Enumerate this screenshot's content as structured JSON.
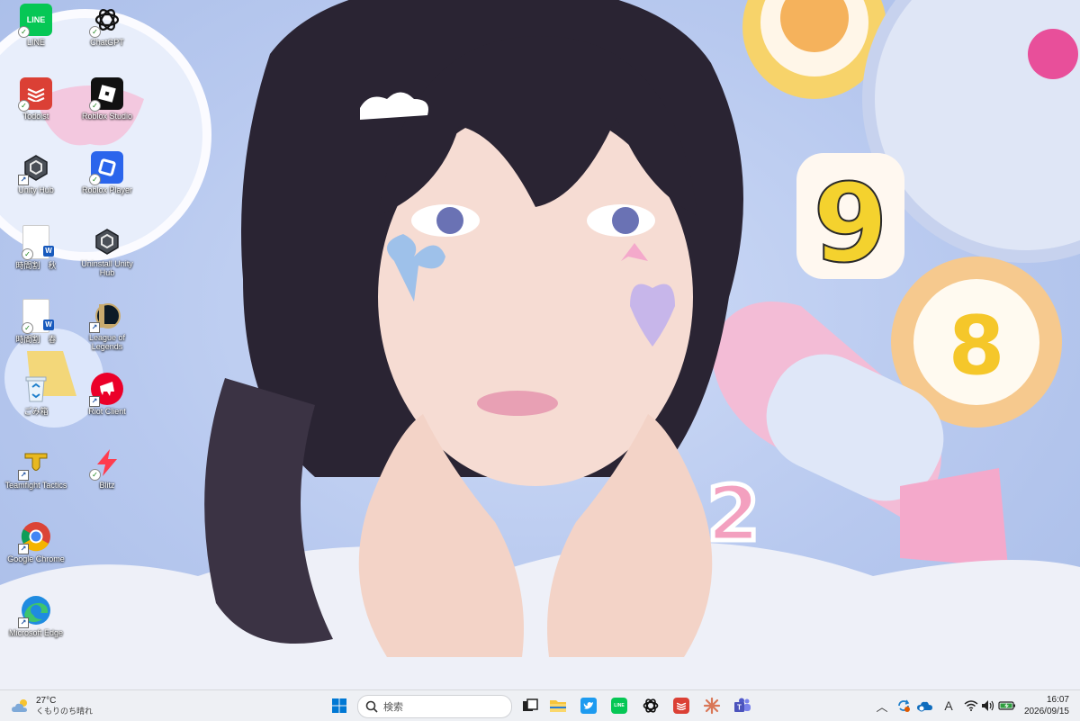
{
  "desktop": {
    "icons": [
      {
        "label": "LINE",
        "icon": "line-icon"
      },
      {
        "label": "ChatGPT",
        "icon": "chatgpt-icon"
      },
      {
        "label": "Todoist",
        "icon": "todoist-icon"
      },
      {
        "label": "Roblox Studio",
        "icon": "roblox-studio-icon"
      },
      {
        "label": "Unity Hub",
        "icon": "unity-hub-icon"
      },
      {
        "label": "Roblox Player",
        "icon": "roblox-player-icon"
      },
      {
        "label": "時間割　秋",
        "icon": "word-document-icon"
      },
      {
        "label": "Uninstall Unity Hub",
        "icon": "unity-uninstall-icon"
      },
      {
        "label": "時間割　春",
        "icon": "word-document-icon"
      },
      {
        "label": "League of Legends",
        "icon": "league-of-legends-icon"
      },
      {
        "label": "ごみ箱",
        "icon": "recycle-bin-icon"
      },
      {
        "label": "Riot Client",
        "icon": "riot-client-icon"
      },
      {
        "label": "Teamfight Tactics",
        "icon": "teamfight-tactics-icon"
      },
      {
        "label": "Blitz",
        "icon": "blitz-icon"
      },
      {
        "label": "Google Chrome",
        "icon": "chrome-icon"
      },
      {
        "label": "Microsoft Edge",
        "icon": "edge-icon"
      }
    ]
  },
  "taskbar": {
    "weather": {
      "temp": "27°C",
      "condition": "くもりのち晴れ",
      "icon": "cloudy-sun-icon"
    },
    "search_placeholder": "検索",
    "apps": [
      "start-icon",
      "task-view-icon",
      "file-explorer-icon",
      "twitter-icon",
      "line-icon",
      "chatgpt-icon",
      "todoist-icon",
      "claude-icon",
      "teams-icon"
    ],
    "tray": {
      "ime": "A"
    },
    "clock": {
      "time": "16:07",
      "date": "2026/09/15"
    }
  },
  "colors": {
    "taskbar_bg": "#eef0f4",
    "accent": "#0067c0",
    "line_green": "#06c755",
    "todoist_red": "#db4035"
  }
}
